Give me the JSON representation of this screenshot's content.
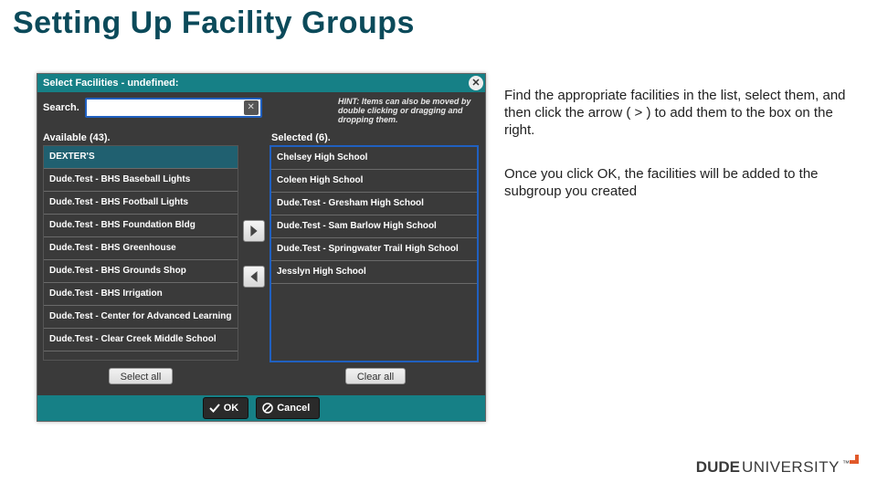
{
  "slide": {
    "title": "Setting Up Facility Groups",
    "paragraph1": "Find the appropriate facilities in the list, select them, and then click the arrow ( > ) to add them to the box on the right.",
    "paragraph2": "Once you click OK, the facilities will be added to the subgroup you created"
  },
  "dialog": {
    "title": "Select Facilities - undefined:",
    "search_label": "Search.",
    "search_value": "",
    "hint": "HINT: Items can also be moved by double clicking or dragging and dropping them.",
    "available_label": "Available (43).",
    "selected_label": "Selected (6).",
    "available_items": [
      "DEXTER'S",
      "Dude.Test - BHS Baseball Lights",
      "Dude.Test - BHS Football Lights",
      "Dude.Test - BHS Foundation Bldg",
      "Dude.Test - BHS Greenhouse",
      "Dude.Test - BHS Grounds Shop",
      "Dude.Test - BHS Irrigation",
      "Dude.Test - Center for Advanced Learning",
      "Dude.Test - Clear Creek Middle School"
    ],
    "selected_items": [
      "Chelsey High School",
      "Coleen High School",
      "Dude.Test - Gresham High School",
      "Dude.Test - Sam Barlow High School",
      "Dude.Test - Springwater Trail High School",
      "Jesslyn High School"
    ],
    "select_all_label": "Select all",
    "clear_all_label": "Clear all",
    "ok_label": "OK",
    "cancel_label": "Cancel"
  },
  "footer": {
    "brand_bold": "DUDE",
    "brand_light": "UNIVERSITY",
    "tm": "™"
  }
}
